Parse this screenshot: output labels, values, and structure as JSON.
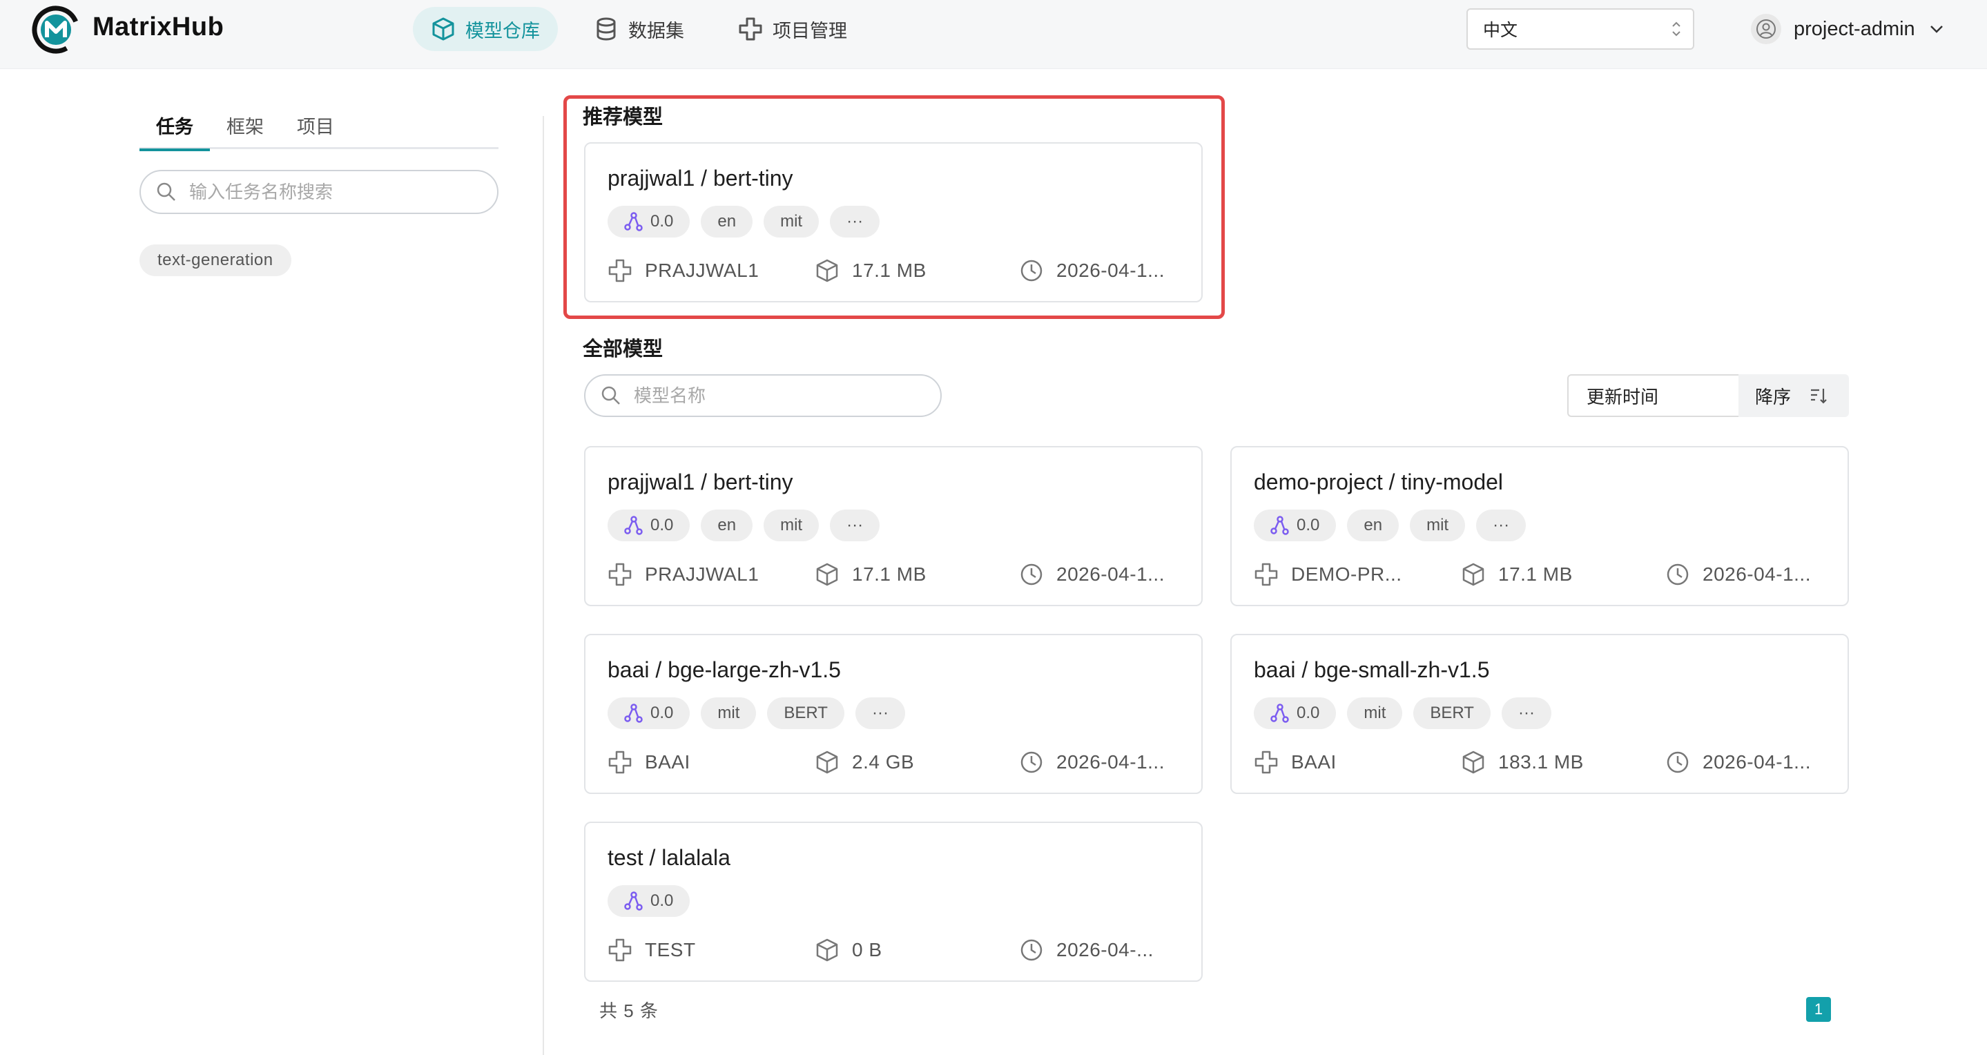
{
  "app": {
    "name": "MatrixHub"
  },
  "nav": [
    {
      "label": "模型仓库",
      "icon": "cube-icon",
      "active": true
    },
    {
      "label": "数据集",
      "icon": "database-icon",
      "active": false
    },
    {
      "label": "项目管理",
      "icon": "project-icon",
      "active": false
    }
  ],
  "language": {
    "value": "中文"
  },
  "user": {
    "name": "project-admin"
  },
  "sidebar": {
    "tabs": [
      {
        "label": "任务",
        "active": true
      },
      {
        "label": "框架",
        "active": false
      },
      {
        "label": "项目",
        "active": false
      }
    ],
    "search_placeholder": "输入任务名称搜索",
    "tags": [
      "text-generation"
    ]
  },
  "recommended": {
    "title": "推荐模型",
    "card": {
      "title": "prajjwal1 / bert-tiny",
      "score": "0.0",
      "tags": [
        "en",
        "mit",
        "···"
      ],
      "org": "PRAJJWAL1",
      "size": "17.1 MB",
      "date": "2026-04-1..."
    }
  },
  "all_models": {
    "title": "全部模型",
    "search_placeholder": "模型名称",
    "sort_field": "更新时间",
    "sort_order": "降序",
    "cards": [
      {
        "title": "prajjwal1 / bert-tiny",
        "score": "0.0",
        "tags": [
          "en",
          "mit",
          "···"
        ],
        "org": "PRAJJWAL1",
        "size": "17.1 MB",
        "date": "2026-04-1..."
      },
      {
        "title": "demo-project / tiny-model",
        "score": "0.0",
        "tags": [
          "en",
          "mit",
          "···"
        ],
        "org": "DEMO-PR...",
        "size": "17.1 MB",
        "date": "2026-04-1..."
      },
      {
        "title": "baai / bge-large-zh-v1.5",
        "score": "0.0",
        "tags": [
          "mit",
          "BERT",
          "···"
        ],
        "org": "BAAI",
        "size": "2.4 GB",
        "date": "2026-04-1..."
      },
      {
        "title": "baai / bge-small-zh-v1.5",
        "score": "0.0",
        "tags": [
          "mit",
          "BERT",
          "···"
        ],
        "org": "BAAI",
        "size": "183.1 MB",
        "date": "2026-04-1..."
      },
      {
        "title": "test / lalalala",
        "score": "0.0",
        "tags": [],
        "org": "TEST",
        "size": "0 B",
        "date": "2026-04-..."
      }
    ],
    "total": "共 5 条",
    "page": "1"
  },
  "colors": {
    "accent": "#13939c",
    "highlight": "#e34848",
    "score_icon": "#7b5cf0"
  }
}
